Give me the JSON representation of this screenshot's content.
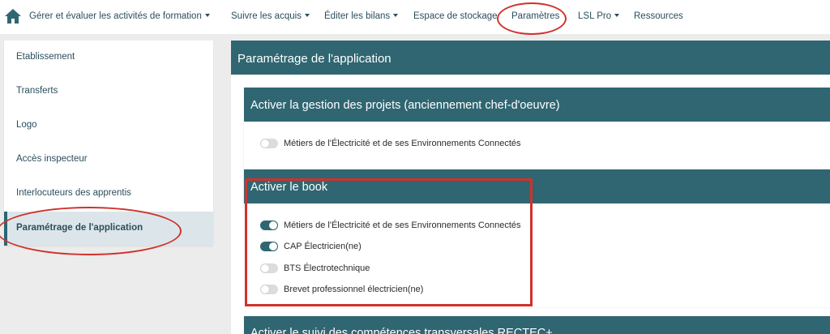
{
  "nav": {
    "items": [
      {
        "label": "Gérer et évaluer les activités de formation",
        "dropdown": true
      },
      {
        "label": "Suivre les acquis",
        "dropdown": true
      },
      {
        "label": "Éditer les bilans",
        "dropdown": true
      },
      {
        "label": "Espace de stockage",
        "dropdown": false
      },
      {
        "label": "Paramètres",
        "dropdown": false,
        "highlighted": true
      },
      {
        "label": "LSL Pro",
        "dropdown": true
      },
      {
        "label": "Ressources",
        "dropdown": false
      }
    ]
  },
  "sidebar": {
    "items": [
      {
        "label": "Etablissement"
      },
      {
        "label": "Transferts"
      },
      {
        "label": "Logo"
      },
      {
        "label": "Accès inspecteur"
      },
      {
        "label": "Interlocuteurs des apprentis"
      },
      {
        "label": "Paramétrage de l'application",
        "active": true
      }
    ]
  },
  "main": {
    "title": "Paramétrage de l'application",
    "sections": [
      {
        "title": "Activer la gestion des projets (anciennement chef-d'oeuvre)",
        "toggles": [
          {
            "label": "Métiers de l'Électricité et de ses Environnements Connectés",
            "on": false
          }
        ]
      },
      {
        "title": "Activer le book",
        "highlighted": true,
        "toggles": [
          {
            "label": "Métiers de l'Électricité et de ses Environnements Connectés",
            "on": true
          },
          {
            "label": "CAP Électricien(ne)",
            "on": true
          },
          {
            "label": "BTS Électrotechnique",
            "on": false
          },
          {
            "label": "Brevet professionnel électricien(ne)",
            "on": false
          }
        ]
      },
      {
        "title": "Activer le suivi des compétences transversales RECTEC+"
      }
    ]
  },
  "colors": {
    "teal": "#2f6672",
    "annotation_red": "#d0322b",
    "toggle_off": "#dcdcdc"
  }
}
